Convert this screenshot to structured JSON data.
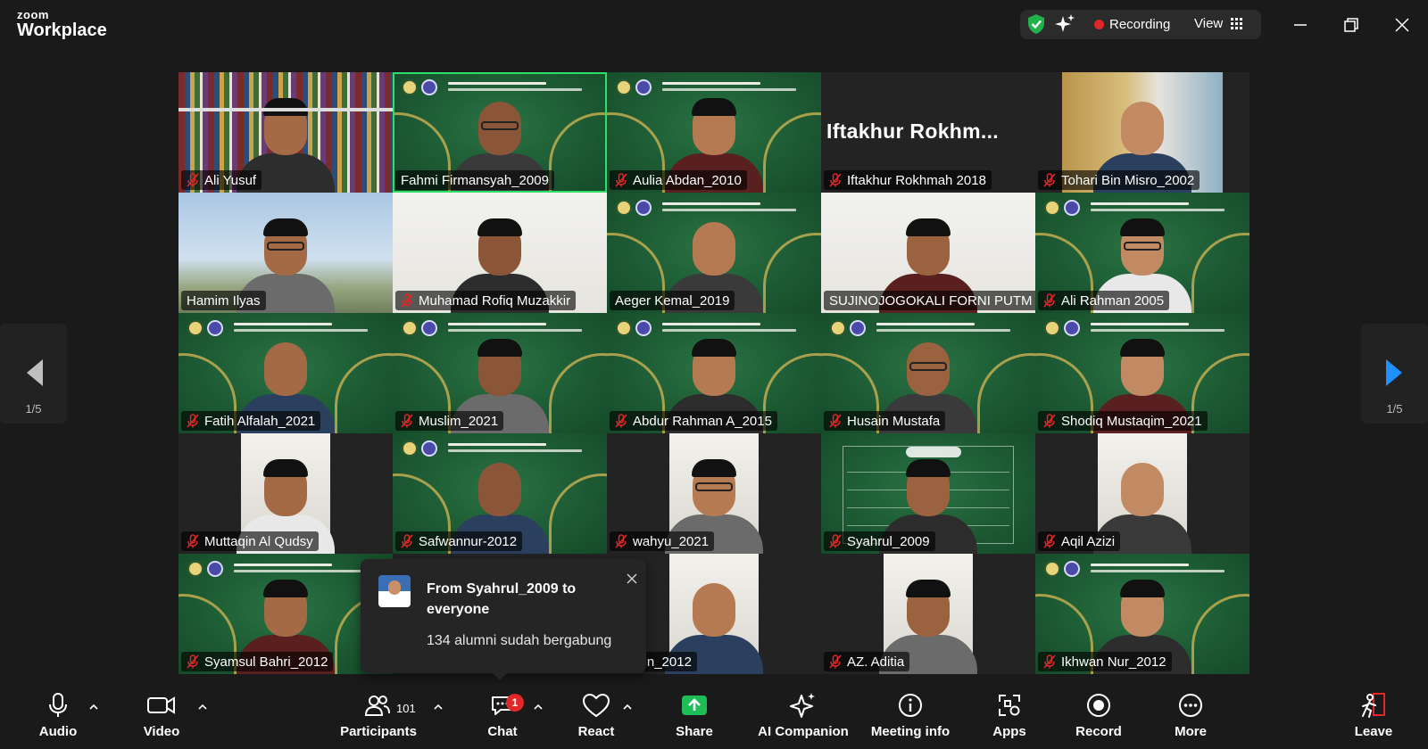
{
  "app": {
    "brand_small": "zoom",
    "brand_large": "Workplace"
  },
  "status": {
    "recording": "Recording",
    "view": "View"
  },
  "icons": [
    "shield-check-icon",
    "ai-sparkle-icon",
    "grid-icon",
    "minimize-icon",
    "restore-icon",
    "close-icon",
    "mic-muted-icon",
    "chevron-left-icon",
    "chevron-right-icon"
  ],
  "colors": {
    "accent_green": "#2ee068",
    "record_red": "#e02828",
    "share_green": "#1fbd57",
    "page_arrow_blue": "#1e90ff",
    "banner_green": "#1d5b34"
  },
  "gallery": {
    "page_left": "1/5",
    "page_right": "1/5",
    "tiles": [
      {
        "name": "Ali Yusuf",
        "muted": true,
        "bg": "books"
      },
      {
        "name": "Fahmi Firmansyah_2009",
        "muted": false,
        "bg": "banner",
        "active_speaker": true
      },
      {
        "name": "Aulia Abdan_2010",
        "muted": true,
        "bg": "banner"
      },
      {
        "name": "Iftakhur Rokhmah 2018",
        "muted": true,
        "bg": "dark",
        "display_name": "Iftakhur  Rokhm..."
      },
      {
        "name": "Tohari Bin Misro_2002",
        "muted": true,
        "bg": "room"
      },
      {
        "name": "Hamim Ilyas",
        "muted": false,
        "bg": "taj"
      },
      {
        "name": "Muhamad Rofiq Muzakkir",
        "muted": true,
        "bg": "white"
      },
      {
        "name": "Aeger Kemal_2019",
        "muted": false,
        "bg": "banner"
      },
      {
        "name": "SUJINOJOGOKALI FORNI PUTM",
        "muted": false,
        "bg": "white"
      },
      {
        "name": "Ali Rahman 2005",
        "muted": true,
        "bg": "banner"
      },
      {
        "name": "Fatih Alfalah_2021",
        "muted": true,
        "bg": "banner"
      },
      {
        "name": "Muslim_2021",
        "muted": true,
        "bg": "banner"
      },
      {
        "name": "Abdur Rahman A_2015",
        "muted": true,
        "bg": "banner"
      },
      {
        "name": "Husain Mustafa",
        "muted": true,
        "bg": "banner"
      },
      {
        "name": "Shodiq Mustaqim_2021",
        "muted": true,
        "bg": "banner"
      },
      {
        "name": "Muttaqin Al Qudsy",
        "muted": true,
        "bg": "dark-portrait"
      },
      {
        "name": "Safwannur-2012",
        "muted": true,
        "bg": "banner"
      },
      {
        "name": "wahyu_2021",
        "muted": true,
        "bg": "dark-portrait"
      },
      {
        "name": "Syahrul_2009",
        "muted": true,
        "bg": "schedule"
      },
      {
        "name": "Aqil Azizi",
        "muted": true,
        "bg": "dark-portrait"
      },
      {
        "name": "Syamsul Bahri_2012",
        "muted": true,
        "bg": "banner"
      },
      {
        "name": "",
        "muted": false,
        "bg": "hidden"
      },
      {
        "name": "zuddin_2012",
        "muted": false,
        "bg": "dark-portrait"
      },
      {
        "name": "AZ. Aditia",
        "muted": true,
        "bg": "dark-portrait"
      },
      {
        "name": "Ikhwan Nur_2012",
        "muted": true,
        "bg": "banner"
      }
    ]
  },
  "chat_popup": {
    "from": "From Syahrul_2009 to everyone",
    "message": "134 alumni sudah bergabung"
  },
  "toolbar": {
    "audio": "Audio",
    "video": "Video",
    "participants": "Participants",
    "participants_count": "101",
    "chat": "Chat",
    "chat_badge": "1",
    "react": "React",
    "share": "Share",
    "ai_companion": "AI Companion",
    "meeting_info": "Meeting info",
    "apps": "Apps",
    "record": "Record",
    "more": "More",
    "leave": "Leave"
  }
}
